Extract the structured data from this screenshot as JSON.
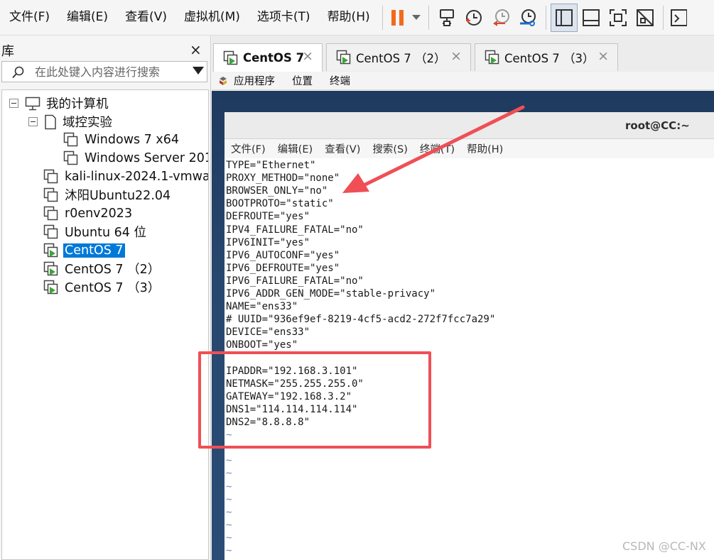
{
  "menubar": {
    "items": [
      "文件(F)",
      "编辑(E)",
      "查看(V)",
      "虚拟机(M)",
      "选项卡(T)",
      "帮助(H)"
    ]
  },
  "toolbar": {
    "buttons": [
      "pause-icon",
      "dropdown-icon",
      "send-keys-icon",
      "snapshot-icon",
      "revert-snapshot-icon",
      "snapshot-manager-icon",
      "library-view-icon",
      "console-view-icon",
      "fullscreen-icon",
      "unity-icon",
      "stretch-icon"
    ],
    "accent_pause": "#f26b1d"
  },
  "library": {
    "title": "库",
    "close": "×",
    "search_placeholder": "在此处键入内容进行搜索",
    "tree": [
      {
        "label": "我的计算机",
        "icon": "computer-icon"
      },
      {
        "label": "域控实验",
        "icon": "folder-icon"
      },
      {
        "label": "Windows 7 x64",
        "icon": "vm-icon"
      },
      {
        "label": "Windows Server 201",
        "icon": "vm-icon"
      },
      {
        "label": "kali-linux-2024.1-vmwa",
        "icon": "vm-icon"
      },
      {
        "label": "沐阳Ubuntu22.04",
        "icon": "vm-icon"
      },
      {
        "label": "r0env2023",
        "icon": "vm-icon"
      },
      {
        "label": "Ubuntu 64 位",
        "icon": "vm-icon"
      },
      {
        "label": "CentOS 7",
        "icon": "vm-running-icon",
        "selected": true
      },
      {
        "label": "CentOS 7 （2）",
        "icon": "vm-running-icon"
      },
      {
        "label": "CentOS 7 （3）",
        "icon": "vm-running-icon"
      }
    ]
  },
  "tabs": [
    {
      "label": "CentOS 7",
      "active": true
    },
    {
      "label": "CentOS 7 （2）"
    },
    {
      "label": "CentOS 7 （3）"
    }
  ],
  "tab_close": "×",
  "gnome_bar": {
    "items": [
      "应用程序",
      "位置",
      "终端"
    ]
  },
  "terminal": {
    "title": "root@CC:~",
    "menu": [
      "文件(F)",
      "编辑(E)",
      "查看(V)",
      "搜索(S)",
      "终端(T)",
      "帮助(H)"
    ],
    "lines": [
      "TYPE=\"Ethernet\"",
      "PROXY_METHOD=\"none\"",
      "BROWSER_ONLY=\"no\"",
      "BOOTPROTO=\"static\"",
      "DEFROUTE=\"yes\"",
      "IPV4_FAILURE_FATAL=\"no\"",
      "IPV6INIT=\"yes\"",
      "IPV6_AUTOCONF=\"yes\"",
      "IPV6_DEFROUTE=\"yes\"",
      "IPV6_FAILURE_FATAL=\"no\"",
      "IPV6_ADDR_GEN_MODE=\"stable-privacy\"",
      "NAME=\"ens33\"",
      "# UUID=\"936ef9ef-8219-4cf5-acd2-272f7fcc7a29\"",
      "DEVICE=\"ens33\"",
      "ONBOOT=\"yes\"",
      "",
      "IPADDR=\"192.168.3.101\"",
      "NETMASK=\"255.255.255.0\"",
      "GATEWAY=\"192.168.3.2\"",
      "DNS1=\"114.114.114.114\"",
      "DNS2=\"8.8.8.8\"",
      "~",
      "~",
      "~",
      "~",
      "~",
      "~",
      "~",
      "~",
      "~",
      "~",
      "~"
    ]
  },
  "annotation_color": "#ef4f55",
  "watermark": "CSDN @CC-NX"
}
